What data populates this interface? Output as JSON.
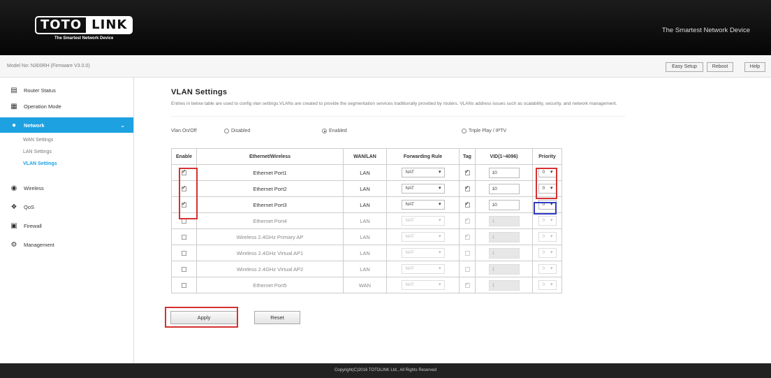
{
  "header": {
    "logo_part1": "TOTO",
    "logo_part2": "LINK",
    "logo_slogan": "The Smartest Network Device",
    "tagline": "The Smartest Network Device"
  },
  "model_bar": {
    "model_text": "Model No: N300RH (Firmware V3.0.0)",
    "buttons": [
      "Easy Setup",
      "Reboot",
      "Help"
    ]
  },
  "sidebar": {
    "items": [
      {
        "label": "Router Status",
        "icon": "monitor-icon"
      },
      {
        "label": "Operation Mode",
        "icon": "network-mode-icon"
      },
      {
        "label": "Network",
        "icon": "globe-icon"
      },
      {
        "label": "Wireless",
        "icon": "wifi-icon"
      },
      {
        "label": "QoS",
        "icon": "qos-icon"
      },
      {
        "label": "Firewall",
        "icon": "lock-icon"
      },
      {
        "label": "Management",
        "icon": "gear-icon"
      }
    ],
    "network_subitems": [
      "WAN Settings",
      "LAN Settings",
      "VLAN Settings"
    ],
    "active_item": "Network",
    "active_subitem": "VLAN Settings"
  },
  "main": {
    "title": "VLAN Settings",
    "description": "Entries in below table are used to config vlan settings.VLANs are created to provide the segmentation services traditionally provided by routers. VLANs address issues such as scalability, security, and network management.",
    "vlan_onoff": {
      "label": "Vlan On/Off",
      "options": [
        "Disabled",
        "Enabled",
        "Triple Play / IPTV"
      ],
      "selected": "Enabled"
    },
    "table": {
      "headers": [
        "Enable",
        "Ethernet/Wireless",
        "WAN/LAN",
        "Forwarding Rule",
        "Tag",
        "VID(1~4096)",
        "Priority"
      ],
      "rows": [
        {
          "enabled": true,
          "name": "Ethernet Port1",
          "wanlan": "LAN",
          "rule": "NAT",
          "tag": true,
          "vid": "10",
          "priority": "0"
        },
        {
          "enabled": true,
          "name": "Ethernet Port2",
          "wanlan": "LAN",
          "rule": "NAT",
          "tag": true,
          "vid": "10",
          "priority": "0"
        },
        {
          "enabled": true,
          "name": "Ethernet Port3",
          "wanlan": "LAN",
          "rule": "NAT",
          "tag": true,
          "vid": "10",
          "priority": "0"
        },
        {
          "enabled": false,
          "name": "Ethernet Port4",
          "wanlan": "LAN",
          "rule": "NAT",
          "tag": true,
          "vid": "1",
          "priority": "0"
        },
        {
          "enabled": false,
          "name": "Wireless 2.4GHz Primary AP",
          "wanlan": "LAN",
          "rule": "NAT",
          "tag": true,
          "vid": "1",
          "priority": "0"
        },
        {
          "enabled": false,
          "name": "Wireless 2.4GHz Virtual AP1",
          "wanlan": "LAN",
          "rule": "NAT",
          "tag": false,
          "vid": "1",
          "priority": "0"
        },
        {
          "enabled": false,
          "name": "Wireless 2.4GHz Virtual AP2",
          "wanlan": "LAN",
          "rule": "NAT",
          "tag": false,
          "vid": "1",
          "priority": "0"
        },
        {
          "enabled": false,
          "name": "Ethernet Port5",
          "wanlan": "WAN",
          "rule": "NAT",
          "tag": true,
          "vid": "1",
          "priority": "0"
        }
      ]
    },
    "apply_label": "Apply",
    "reset_label": "Reset"
  },
  "footer": {
    "text": "Copyright(C)2016 TOTOLINK Ltd., All Rights Reserved"
  },
  "colors": {
    "accent": "#1da1e0",
    "highlight_red": "#d63131",
    "highlight_blue": "#2f3cc4"
  }
}
